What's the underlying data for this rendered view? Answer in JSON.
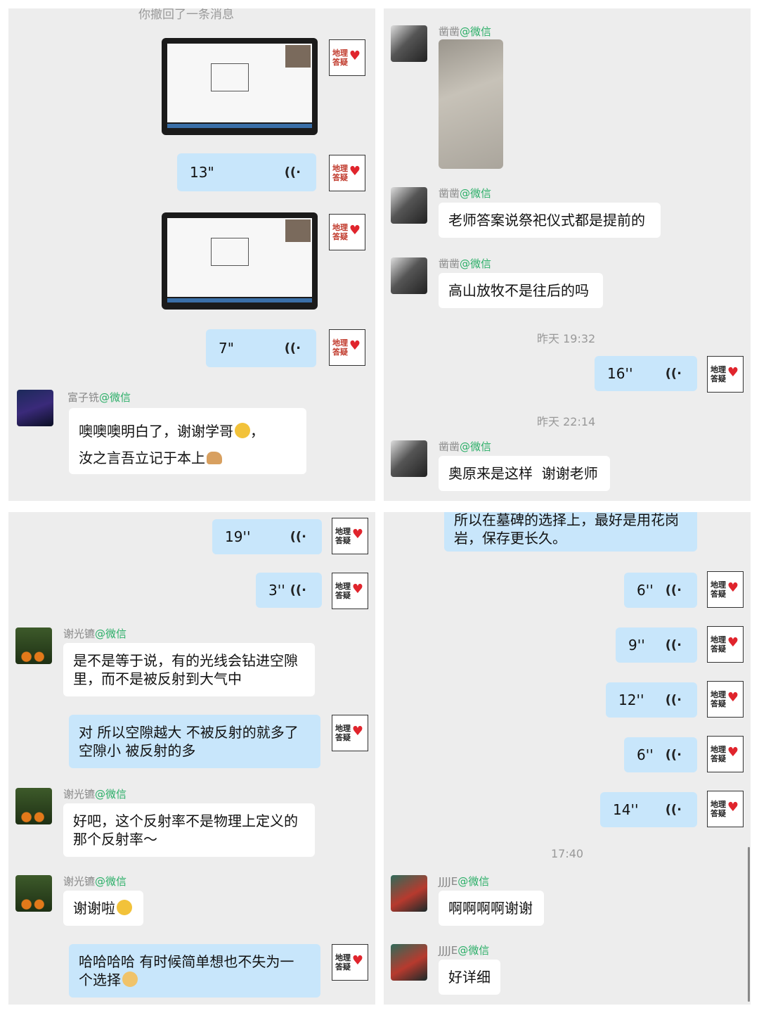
{
  "p1": {
    "recall_notice": "你撤回了一条消息",
    "voice1": "13\"",
    "voice2": "7\"",
    "sender": {
      "name": "富子铣",
      "tag": "@微信"
    },
    "msg_line1": "噢噢噢明白了，谢谢学哥",
    "msg_line1_end": "，",
    "msg_line2": "汝之言吾立记于本上"
  },
  "p2": {
    "sender_name": "凿凿",
    "tag": "@微信",
    "msg1": "老师答案说祭祀仪式都是提前的",
    "msg2": "高山放牧不是往后的吗",
    "time1": "昨天 19:32",
    "voice1": "16''",
    "time2": "昨天 22:14",
    "msg3": "奥原来是这样  谢谢老师"
  },
  "p3": {
    "voice1": "19''",
    "voice2": "3''",
    "sender_name": "谢光镳",
    "tag": "@微信",
    "msg1_l1": "是不是等于说，有的光线会钻进空隙",
    "msg1_l2": "里，而不是被反射到大气中",
    "reply1_l1": "对 所以空隙越大 不被反射的就多了",
    "reply1_l2": "空隙小 被反射的多",
    "msg2_l1": "好吧，这个反射率不是物理上定义的",
    "msg2_l2": "那个反射率～",
    "msg3": "谢谢啦",
    "reply2_l1": "哈哈哈哈 有时候简单想也不失为一",
    "reply2_l2": "个选择"
  },
  "p4": {
    "top_l1": "所以在墓碑的选择上，最好是用花岗",
    "top_l2": "岩，保存更长久。",
    "voices": [
      "6''",
      "9''",
      "12''",
      "6''",
      "14''"
    ],
    "time": "17:40",
    "sender_name": "JJJJE",
    "tag": "@微信",
    "msg1": "啊啊啊啊谢谢",
    "msg2": "好详细"
  },
  "logo_text": "地理答疑",
  "voice_icon": "voice-wave-icon",
  "colors": {
    "bubble_blue": "#c8e6fb",
    "wechat_green": "#2aae67",
    "panel_bg": "#ededed"
  }
}
